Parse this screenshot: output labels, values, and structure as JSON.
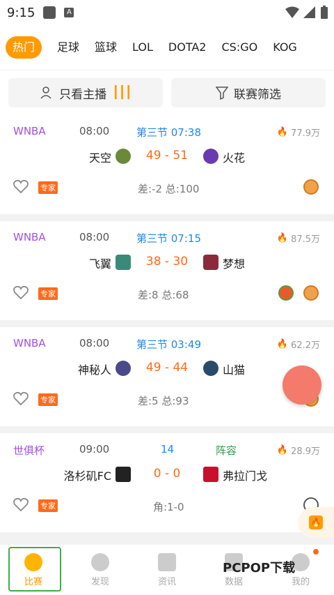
{
  "status": {
    "time": "9:15"
  },
  "tabs": [
    "热门",
    "足球",
    "篮球",
    "LOL",
    "DOTA2",
    "CS:GO",
    "KOG"
  ],
  "filters": {
    "anchor": "只看主播",
    "league": "联赛筛选"
  },
  "matches": [
    {
      "league": "WNBA",
      "time": "08:00",
      "period": "第三节 07:38",
      "heat": "77.9万",
      "home": "天空",
      "away": "火花",
      "score_home": "49",
      "score_away": "51",
      "expert": "专家",
      "stat": "差:-2 总:100"
    },
    {
      "league": "WNBA",
      "time": "08:00",
      "period": "第三节 07:15",
      "heat": "87.5万",
      "home": "飞翼",
      "away": "梦想",
      "score_home": "38",
      "score_away": "30",
      "expert": "专家",
      "stat": "差:8 总:68"
    },
    {
      "league": "WNBA",
      "time": "08:00",
      "period": "第三节 03:49",
      "heat": "62.2万",
      "home": "神秘人",
      "away": "山猫",
      "score_home": "49",
      "score_away": "44",
      "expert": "专家",
      "stat": "差:5 总:93"
    },
    {
      "league": "世俱杯",
      "time": "09:00",
      "period": "14",
      "extra": "阵容",
      "heat": "28.9万",
      "home": "洛杉矶FC",
      "away": "弗拉门戈",
      "score_home": "0",
      "score_away": "0",
      "expert": "专家",
      "stat": "角:1-0"
    }
  ],
  "score_sep": "-",
  "nav": [
    "比赛",
    "发现",
    "资讯",
    "数据",
    "我的"
  ],
  "watermark": "PCPOP下载"
}
